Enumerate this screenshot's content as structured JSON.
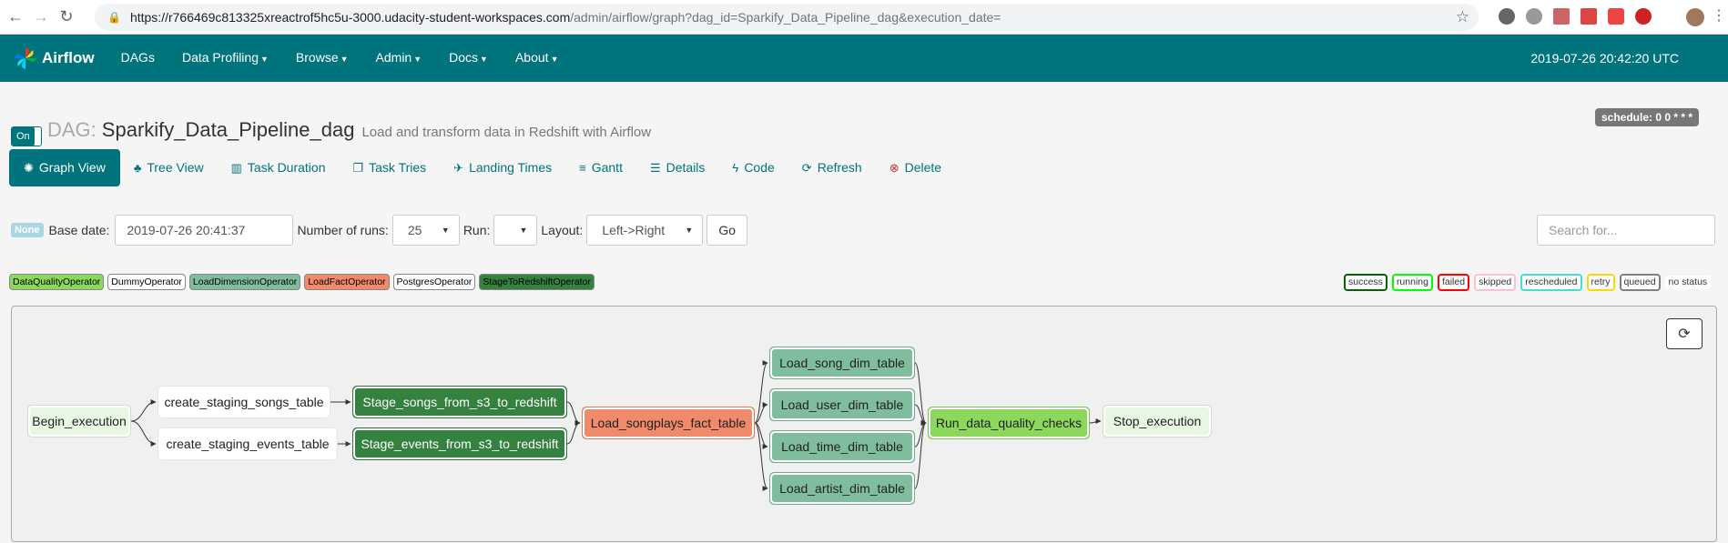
{
  "browser": {
    "url_host": "https://r766469c813325xreactrof5hc5u-3000.udacity-student-workspaces.com",
    "url_path": "/admin/airflow/graph?dag_id=Sparkify_Data_Pipeline_dag&execution_date="
  },
  "navbar": {
    "brand": "Airflow",
    "items": [
      {
        "label": "DAGs",
        "dropdown": false
      },
      {
        "label": "Data Profiling",
        "dropdown": true
      },
      {
        "label": "Browse",
        "dropdown": true
      },
      {
        "label": "Admin",
        "dropdown": true
      },
      {
        "label": "Docs",
        "dropdown": true
      },
      {
        "label": "About",
        "dropdown": true
      }
    ],
    "clock": "2019-07-26 20:42:20 UTC"
  },
  "header": {
    "toggle_label": "On",
    "prefix": "DAG:",
    "dag_id": "Sparkify_Data_Pipeline_dag",
    "description": "Load and transform data in Redshift with Airflow",
    "schedule": "schedule: 0 0 * * *"
  },
  "tabs": [
    {
      "label": "Graph View",
      "icon": "asterisk-icon",
      "glyph": "✺"
    },
    {
      "label": "Tree View",
      "icon": "tree-icon",
      "glyph": "♣"
    },
    {
      "label": "Task Duration",
      "icon": "bar-chart-icon",
      "glyph": "▥"
    },
    {
      "label": "Task Tries",
      "icon": "duplicate-icon",
      "glyph": "❐"
    },
    {
      "label": "Landing Times",
      "icon": "plane-icon",
      "glyph": "✈"
    },
    {
      "label": "Gantt",
      "icon": "align-left-icon",
      "glyph": "≡"
    },
    {
      "label": "Details",
      "icon": "list-icon",
      "glyph": "☰"
    },
    {
      "label": "Code",
      "icon": "flash-icon",
      "glyph": "ϟ"
    },
    {
      "label": "Refresh",
      "icon": "refresh-icon",
      "glyph": "⟳"
    },
    {
      "label": "Delete",
      "icon": "remove-circle-icon",
      "glyph": "⊗"
    }
  ],
  "form": {
    "state_badge": "None",
    "base_date_label": "Base date:",
    "base_date_value": "2019-07-26 20:41:37",
    "num_runs_label": "Number of runs:",
    "num_runs_value": "25",
    "run_label": "Run:",
    "run_value": "",
    "layout_label": "Layout:",
    "layout_value": "Left->Right",
    "go_label": "Go",
    "search_placeholder": "Search for..."
  },
  "operators": [
    {
      "label": "DataQualityOperator",
      "color": "#8bd85c"
    },
    {
      "label": "DummyOperator",
      "color": "#ffffff"
    },
    {
      "label": "LoadDimensionOperator",
      "color": "#80bd9e"
    },
    {
      "label": "LoadFactOperator",
      "color": "#f08a6a"
    },
    {
      "label": "PostgresOperator",
      "color": "#ffffff"
    },
    {
      "label": "StageToRedshiftOperator",
      "color": "#358140"
    }
  ],
  "states": [
    {
      "label": "success",
      "color": "#006400"
    },
    {
      "label": "running",
      "color": "#00ff00"
    },
    {
      "label": "failed",
      "color": "#ff0000"
    },
    {
      "label": "skipped",
      "color": "#ffc0cb"
    },
    {
      "label": "rescheduled",
      "color": "#40e0d0"
    },
    {
      "label": "retry",
      "color": "#ffd700"
    },
    {
      "label": "queued",
      "color": "#808080"
    },
    {
      "label": "no status",
      "color": ""
    }
  ],
  "nodes": [
    {
      "id": "Begin_execution",
      "color": "#e8f7e4",
      "text_color": "#222"
    },
    {
      "id": "create_staging_songs_table",
      "color": "#ffffff",
      "text_color": "#222"
    },
    {
      "id": "create_staging_events_table",
      "color": "#ffffff",
      "text_color": "#222"
    },
    {
      "id": "Stage_songs_from_s3_to_redshift",
      "color": "#358140",
      "text_color": "#fff"
    },
    {
      "id": "Stage_events_from_s3_to_redshift",
      "color": "#358140",
      "text_color": "#fff"
    },
    {
      "id": "Load_songplays_fact_table",
      "color": "#f08a6a",
      "text_color": "#222"
    },
    {
      "id": "Load_song_dim_table",
      "color": "#80bd9e",
      "text_color": "#222"
    },
    {
      "id": "Load_user_dim_table",
      "color": "#80bd9e",
      "text_color": "#222"
    },
    {
      "id": "Load_time_dim_table",
      "color": "#80bd9e",
      "text_color": "#222"
    },
    {
      "id": "Load_artist_dim_table",
      "color": "#80bd9e",
      "text_color": "#222"
    },
    {
      "id": "Run_data_quality_checks",
      "color": "#8bd85c",
      "text_color": "#222"
    },
    {
      "id": "Stop_execution",
      "color": "#e8f7e4",
      "text_color": "#222"
    }
  ],
  "edges": [
    [
      "Begin_execution",
      "create_staging_songs_table"
    ],
    [
      "Begin_execution",
      "create_staging_events_table"
    ],
    [
      "create_staging_songs_table",
      "Stage_songs_from_s3_to_redshift"
    ],
    [
      "create_staging_events_table",
      "Stage_events_from_s3_to_redshift"
    ],
    [
      "Stage_songs_from_s3_to_redshift",
      "Load_songplays_fact_table"
    ],
    [
      "Stage_events_from_s3_to_redshift",
      "Load_songplays_fact_table"
    ],
    [
      "Load_songplays_fact_table",
      "Load_song_dim_table"
    ],
    [
      "Load_songplays_fact_table",
      "Load_user_dim_table"
    ],
    [
      "Load_songplays_fact_table",
      "Load_time_dim_table"
    ],
    [
      "Load_songplays_fact_table",
      "Load_artist_dim_table"
    ],
    [
      "Load_song_dim_table",
      "Run_data_quality_checks"
    ],
    [
      "Load_user_dim_table",
      "Run_data_quality_checks"
    ],
    [
      "Load_time_dim_table",
      "Run_data_quality_checks"
    ],
    [
      "Load_artist_dim_table",
      "Run_data_quality_checks"
    ],
    [
      "Run_data_quality_checks",
      "Stop_execution"
    ]
  ]
}
